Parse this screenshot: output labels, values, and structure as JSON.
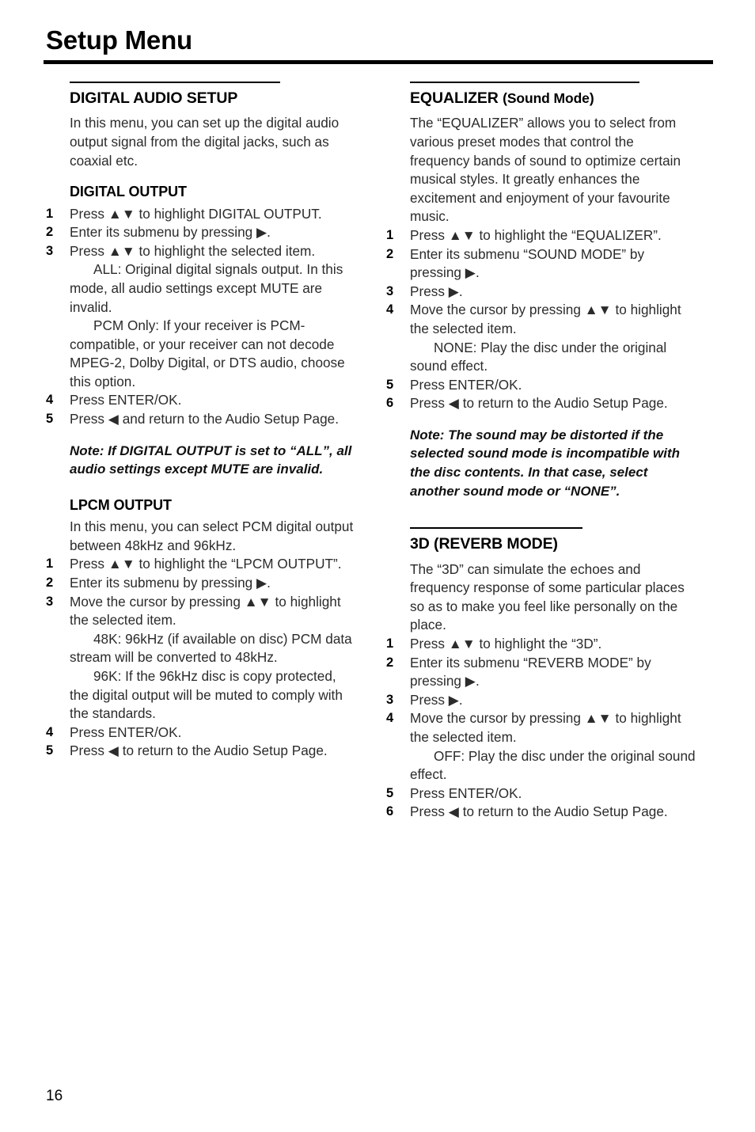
{
  "page": {
    "title": "Setup Menu",
    "number": "16"
  },
  "left_column": {
    "section": {
      "heading": "DIGITAL AUDIO SETUP",
      "intro": "In this menu, you can set up the digital audio output signal from the digital jacks, such as coaxial etc."
    },
    "digital_output": {
      "heading": "DIGITAL OUTPUT",
      "steps": [
        {
          "num": "1",
          "text": "Press ▲▼ to highlight DIGITAL OUTPUT."
        },
        {
          "num": "2",
          "text": "Enter its submenu by pressing ▶."
        },
        {
          "num": "3",
          "text": "Press ▲▼ to highlight the selected item."
        }
      ],
      "options": [
        "ALL: Original digital signals output. In this mode, all audio settings except MUTE are invalid.",
        "PCM Only: If your receiver is PCM-compatible, or your receiver can not decode MPEG-2, Dolby Digital, or DTS audio, choose this option."
      ],
      "steps_after": [
        {
          "num": "4",
          "text": "Press ENTER/OK."
        },
        {
          "num": "5",
          "text": "Press ◀ and return to the Audio Setup Page."
        }
      ],
      "note": "Note: If DIGITAL OUTPUT is set to “ALL”, all audio settings except MUTE are invalid."
    },
    "lpcm_output": {
      "heading": "LPCM OUTPUT",
      "intro": "In this menu, you can select PCM digital output between 48kHz and 96kHz.",
      "steps": [
        {
          "num": "1",
          "text": "Press ▲▼ to highlight the “LPCM OUTPUT”."
        },
        {
          "num": "2",
          "text": "Enter its submenu by pressing ▶."
        },
        {
          "num": "3",
          "text": "Move the cursor by pressing ▲▼ to highlight the selected item."
        }
      ],
      "options": [
        "48K: 96kHz (if available on disc) PCM data stream will be converted to 48kHz.",
        "96K: If the 96kHz disc is copy protected, the digital output will be muted to comply with the standards."
      ],
      "steps_after": [
        {
          "num": "4",
          "text": "Press ENTER/OK."
        },
        {
          "num": "5",
          "text": "Press ◀ to return to the Audio Setup Page."
        }
      ]
    }
  },
  "right_column": {
    "equalizer": {
      "heading_main": "EQUALIZER",
      "heading_sub": "(Sound Mode)",
      "intro": "The “EQUALIZER” allows you to select from various preset modes that control the frequency bands of sound to optimize certain musical styles. It greatly enhances the excitement and enjoyment of your favourite music.",
      "steps": [
        {
          "num": "1",
          "text": "Press ▲▼ to highlight the “EQUALIZER”."
        },
        {
          "num": "2",
          "text": "Enter its submenu “SOUND MODE” by pressing ▶."
        },
        {
          "num": "3",
          "text": "Press ▶."
        },
        {
          "num": "4",
          "text": "Move the cursor by pressing ▲▼ to highlight the selected item."
        }
      ],
      "options": [
        "NONE: Play the disc under the original sound effect."
      ],
      "steps_after": [
        {
          "num": "5",
          "text": "Press ENTER/OK."
        },
        {
          "num": "6",
          "text": "Press ◀ to return to the Audio Setup Page."
        }
      ],
      "note": "Note: The sound may be distorted if the selected sound mode is incompatible with the disc contents. In that case, select another sound mode or “NONE”."
    },
    "reverb": {
      "heading": "3D (REVERB MODE)",
      "intro": "The “3D” can simulate the echoes and frequency response of some particular places so as to make you feel like personally on the place.",
      "steps": [
        {
          "num": "1",
          "text": "Press ▲▼ to highlight the “3D”."
        },
        {
          "num": "2",
          "text": "Enter its submenu “REVERB MODE” by pressing ▶."
        },
        {
          "num": "3",
          "text": "Press ▶."
        },
        {
          "num": "4",
          "text": "Move the cursor by pressing ▲▼ to highlight the selected item."
        }
      ],
      "options": [
        "OFF: Play the disc under the original sound effect."
      ],
      "steps_after": [
        {
          "num": "5",
          "text": "Press ENTER/OK."
        },
        {
          "num": "6",
          "text": "Press ◀ to return to the Audio Setup Page."
        }
      ]
    }
  }
}
